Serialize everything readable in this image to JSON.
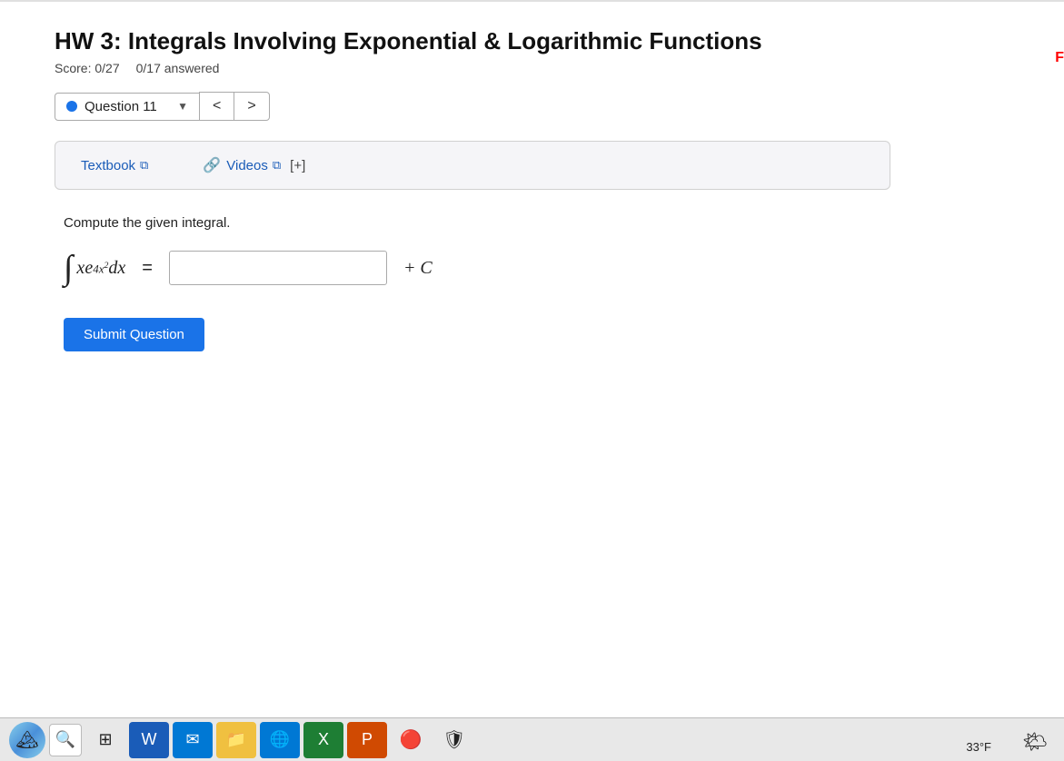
{
  "page": {
    "header_border": true
  },
  "hw": {
    "title": "HW 3: Integrals Involving Exponential & Logarithmic Functions",
    "score_label": "Score: 0/27",
    "answered_label": "0/17 answered"
  },
  "question_nav": {
    "question_label": "Question 11",
    "prev_btn": "<",
    "next_btn": ">"
  },
  "resources": {
    "textbook_label": "Textbook",
    "textbook_ext_icon": "⧉",
    "videos_label": "Videos",
    "videos_ext_icon": "⧉",
    "plus_bracket": "[+]"
  },
  "question": {
    "instruction": "Compute the given integral.",
    "integral_display": "∫xe^{4x²}dx",
    "equals": "=",
    "plus_c": "+ C",
    "answer_placeholder": ""
  },
  "submit": {
    "label": "Submit Question"
  },
  "taskbar": {
    "items": [
      "🔍",
      "⊞",
      "W",
      "✉",
      "📁",
      "🌐",
      "X",
      "P",
      "G"
    ]
  },
  "weather": {
    "temp": "33°F",
    "icon": "🌤"
  },
  "right_edge": {
    "text": "F"
  }
}
